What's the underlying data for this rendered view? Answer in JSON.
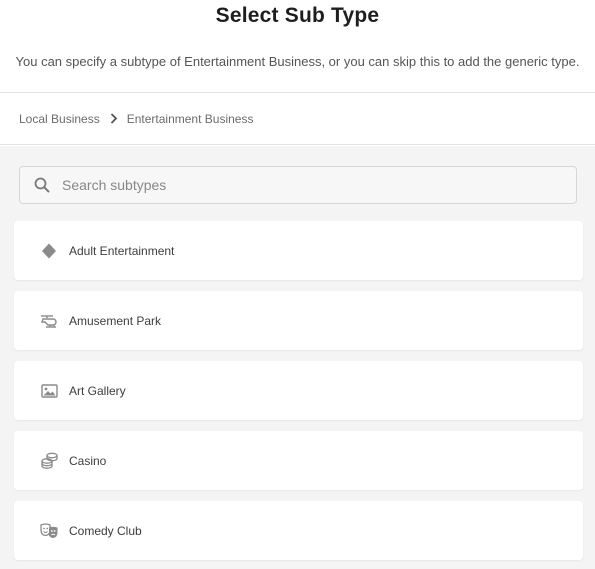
{
  "header": {
    "title": "Select Sub Type",
    "subtitle": "You can specify a subtype of Entertainment Business, or you can skip this to add the generic type."
  },
  "breadcrumb": {
    "items": [
      "Local Business",
      "Entertainment Business"
    ],
    "separator_icon": "chevron-right-icon"
  },
  "search": {
    "placeholder": "Search subtypes",
    "value": "",
    "icon": "search-icon"
  },
  "subtypes": [
    {
      "label": "Adult Entertainment",
      "icon": "diamond-icon"
    },
    {
      "label": "Amusement Park",
      "icon": "helicopter-icon"
    },
    {
      "label": "Art Gallery",
      "icon": "image-icon"
    },
    {
      "label": "Casino",
      "icon": "coins-icon"
    },
    {
      "label": "Comedy Club",
      "icon": "theater-masks-icon"
    }
  ],
  "colors": {
    "page_background": "#ffffff",
    "list_background": "#f4f4f4",
    "card_background": "#ffffff",
    "icon_gray": "#888888",
    "divider": "#e3e3e3"
  }
}
